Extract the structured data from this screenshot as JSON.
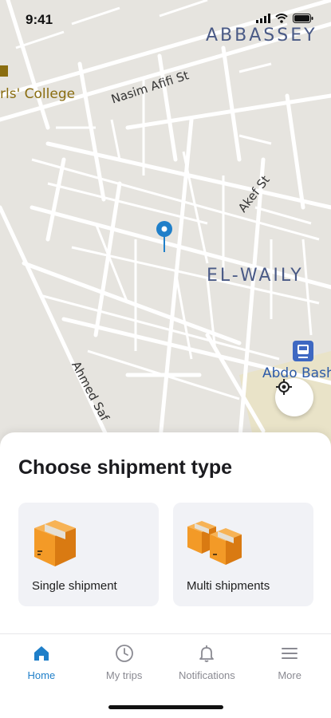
{
  "status": {
    "time": "9:41"
  },
  "map": {
    "labels": {
      "abbassey": "ABBASSEY",
      "el_waily": "EL-WAILY",
      "nasim_afifi": "Nasim Afifi St",
      "akef": "Akef St",
      "ahmed_saf": "Ahmed Saf",
      "college": "rls' College",
      "abdo_bash": "Abdo Bash"
    },
    "colors": {
      "road": "#ffffff",
      "land": "#e6e4df",
      "pin": "#1f7fc9",
      "district": "#4a5a86"
    }
  },
  "sheet": {
    "title": "Choose shipment type",
    "options": [
      {
        "label": "Single shipment",
        "icon": "box-icon"
      },
      {
        "label": "Multi shipments",
        "icon": "boxes-icon"
      }
    ]
  },
  "tabs": [
    {
      "label": "Home",
      "icon": "home-icon",
      "active": true
    },
    {
      "label": "My trips",
      "icon": "clock-icon",
      "active": false
    },
    {
      "label": "Notifications",
      "icon": "bell-icon",
      "active": false
    },
    {
      "label": "More",
      "icon": "menu-icon",
      "active": false
    }
  ],
  "accent_color": "#1f7fc9"
}
